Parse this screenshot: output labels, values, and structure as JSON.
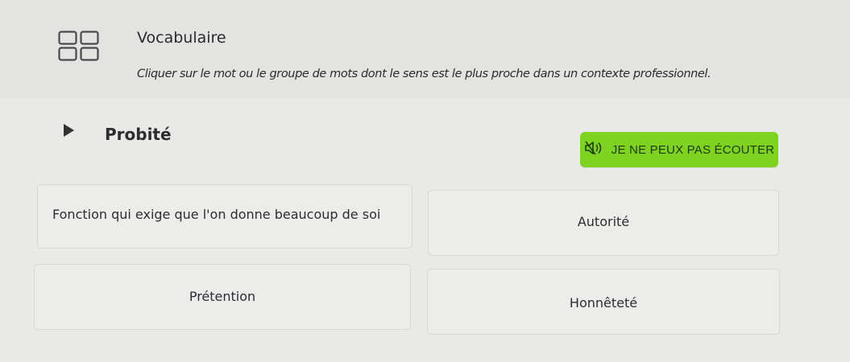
{
  "header": {
    "icon": "grid-icon",
    "section_title": "Vocabulaire",
    "instruction": "Cliquer sur le mot ou le groupe de mots dont le sens est le plus proche dans un contexte professionnel."
  },
  "question": {
    "play_icon": "play-triangle-icon",
    "word": "Probité"
  },
  "cant_listen_button": {
    "icon": "speaker-muted-icon",
    "label": "JE NE PEUX PAS ÉCOUTER",
    "color": "#7ed321"
  },
  "options": [
    {
      "label": "Fonction qui exige que l'on donne beaucoup de soi"
    },
    {
      "label": "Autorité"
    },
    {
      "label": "Prétention"
    },
    {
      "label": "Honnêteté"
    }
  ]
}
